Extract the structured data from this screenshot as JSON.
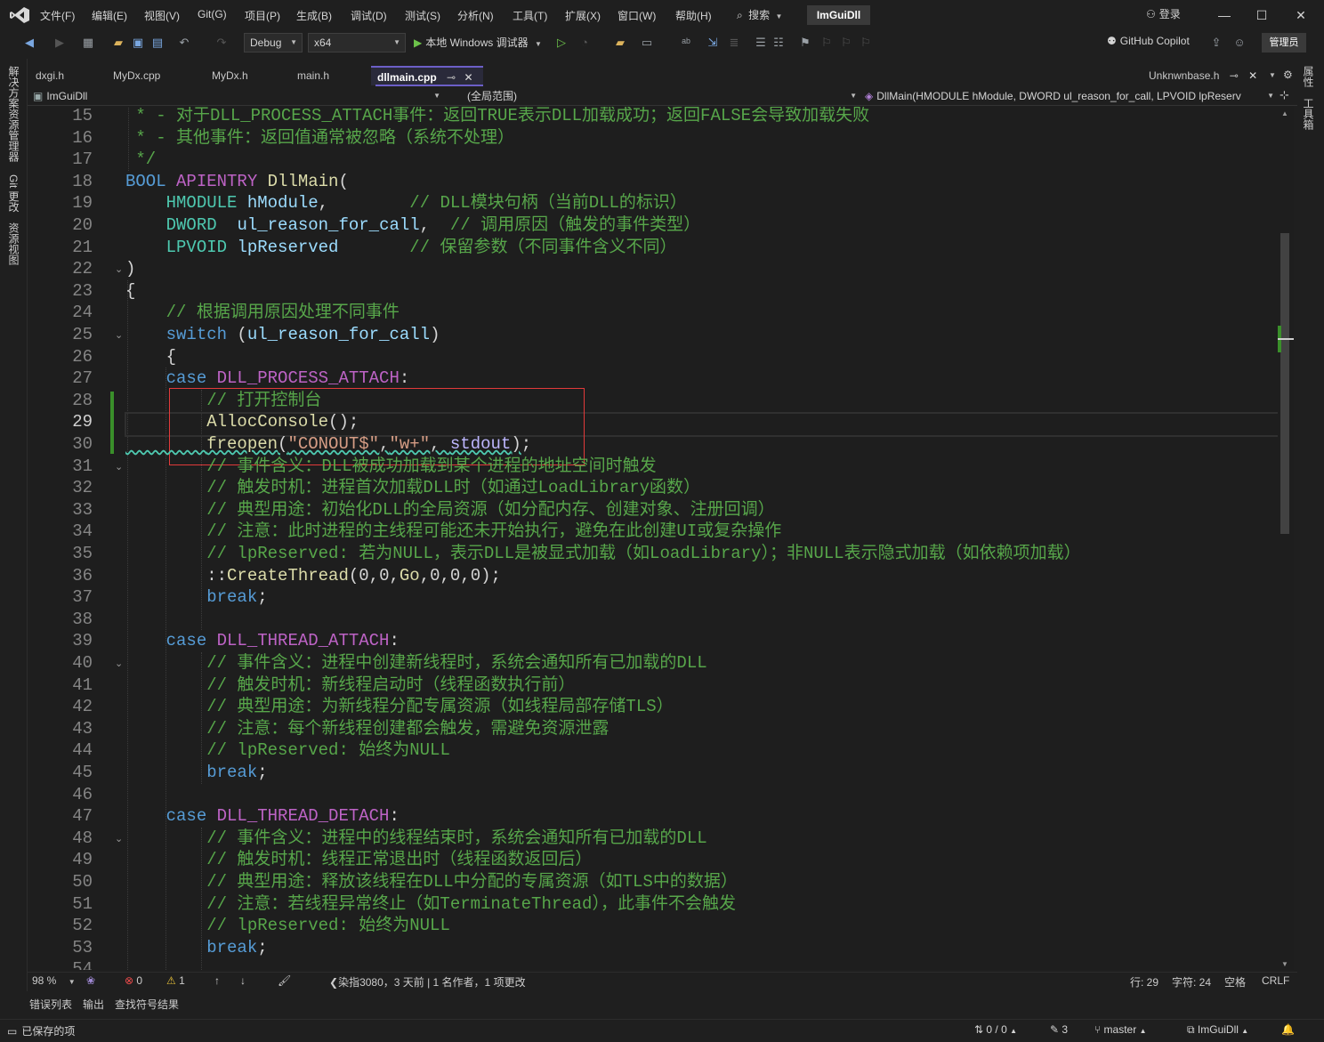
{
  "titlebar": {
    "menu": [
      "文件(F)",
      "编辑(E)",
      "视图(V)",
      "Git(G)",
      "项目(P)",
      "生成(B)",
      "调试(D)",
      "测试(S)",
      "分析(N)",
      "工具(T)",
      "扩展(X)",
      "窗口(W)",
      "帮助(H)"
    ],
    "search_label": "搜索",
    "solution_name": "ImGuiDll",
    "login_label": "登录"
  },
  "toolbar": {
    "config": "Debug",
    "platform": "x64",
    "run_label": "本地 Windows 调试器",
    "copilot_label": "GitHub Copilot",
    "admin_label": "管理员"
  },
  "side_left": [
    "解决方案资源管理器",
    "Git 更改",
    "资源视图"
  ],
  "side_right": [
    "属性",
    "工具箱"
  ],
  "tabs": [
    {
      "label": "dxgi.h",
      "active": false
    },
    {
      "label": "MyDx.cpp",
      "active": false
    },
    {
      "label": "MyDx.h",
      "active": false
    },
    {
      "label": "main.h",
      "active": false
    },
    {
      "label": "dllmain.cpp",
      "active": true
    },
    {
      "label": "Unknwnbase.h",
      "active": false
    }
  ],
  "navbar": {
    "project": "ImGuiDll",
    "scope": "(全局范围)",
    "member": "DllMain(HMODULE hModule, DWORD ul_reason_for_call, LPVOID lpReserv"
  },
  "editor": {
    "current_line": 29,
    "lines": [
      {
        "n": "15",
        "text": " * - 对于DLL_PROCESS_ATTACH事件：返回TRUE表示DLL加载成功；返回FALSE会导致加载失败"
      },
      {
        "n": "16",
        "text": " * - 其他事件：返回值通常被忽略（系统不处理）"
      },
      {
        "n": "17",
        "text": " */"
      },
      {
        "n": "18",
        "text": "BOOL APIENTRY DllMain("
      },
      {
        "n": "19",
        "text": "    HMODULE hModule,        // DLL模块句柄（当前DLL的标识）"
      },
      {
        "n": "20",
        "text": "    DWORD  ul_reason_for_call,  // 调用原因（触发的事件类型）"
      },
      {
        "n": "21",
        "text": "    LPVOID lpReserved       // 保留参数（不同事件含义不同）"
      },
      {
        "n": "22",
        "text": ")"
      },
      {
        "n": "23",
        "text": "{"
      },
      {
        "n": "24",
        "text": "    // 根据调用原因处理不同事件"
      },
      {
        "n": "25",
        "text": "    switch (ul_reason_for_call)"
      },
      {
        "n": "26",
        "text": "    {"
      },
      {
        "n": "27",
        "text": "    case DLL_PROCESS_ATTACH:"
      },
      {
        "n": "28",
        "text": "        // 打开控制台"
      },
      {
        "n": "29",
        "text": "        AllocConsole();"
      },
      {
        "n": "30",
        "text": "        freopen(\"CONOUT$\",\"w+\", stdout);"
      },
      {
        "n": "31",
        "text": "        // 事件含义：DLL被成功加载到某个进程的地址空间时触发"
      },
      {
        "n": "32",
        "text": "        // 触发时机：进程首次加载DLL时（如通过LoadLibrary函数）"
      },
      {
        "n": "33",
        "text": "        // 典型用途：初始化DLL的全局资源（如分配内存、创建对象、注册回调）"
      },
      {
        "n": "34",
        "text": "        // 注意：此时进程的主线程可能还未开始执行，避免在此创建UI或复杂操作"
      },
      {
        "n": "35",
        "text": "        // lpReserved: 若为NULL，表示DLL是被显式加载（如LoadLibrary）；非NULL表示隐式加载（如依赖项加载）"
      },
      {
        "n": "36",
        "text": "        ::CreateThread(0,0,Go,0,0,0);"
      },
      {
        "n": "37",
        "text": "        break;"
      },
      {
        "n": "38",
        "text": ""
      },
      {
        "n": "39",
        "text": "    case DLL_THREAD_ATTACH:"
      },
      {
        "n": "40",
        "text": "        // 事件含义：进程中创建新线程时，系统会通知所有已加载的DLL"
      },
      {
        "n": "41",
        "text": "        // 触发时机：新线程启动时（线程函数执行前）"
      },
      {
        "n": "42",
        "text": "        // 典型用途：为新线程分配专属资源（如线程局部存储TLS）"
      },
      {
        "n": "43",
        "text": "        // 注意：每个新线程创建都会触发，需避免资源泄露"
      },
      {
        "n": "44",
        "text": "        // lpReserved: 始终为NULL"
      },
      {
        "n": "45",
        "text": "        break;"
      },
      {
        "n": "46",
        "text": ""
      },
      {
        "n": "47",
        "text": "    case DLL_THREAD_DETACH:"
      },
      {
        "n": "48",
        "text": "        // 事件含义：进程中的线程结束时，系统会通知所有已加载的DLL"
      },
      {
        "n": "49",
        "text": "        // 触发时机：线程正常退出时（线程函数返回后）"
      },
      {
        "n": "50",
        "text": "        // 典型用途：释放该线程在DLL中分配的专属资源（如TLS中的数据）"
      },
      {
        "n": "51",
        "text": "        // 注意：若线程异常终止（如TerminateThread），此事件不会触发"
      },
      {
        "n": "52",
        "text": "        // lpReserved: 始终为NULL"
      },
      {
        "n": "53",
        "text": "        break;"
      },
      {
        "n": "54",
        "text": ""
      }
    ]
  },
  "editor_status": {
    "zoom": "98 %",
    "errors": "0",
    "warnings": "1",
    "blame": "染指3080，3 天前 | 1 名作者，1 项更改",
    "line": "行: 29",
    "char": "字符: 24",
    "whitespace": "空格",
    "eol": "CRLF"
  },
  "panel_tabs": [
    "错误列表",
    "输出",
    "查找符号结果"
  ],
  "statusbar": {
    "saved": "已保存的项",
    "sync": "0 / 0",
    "pencil_count": "3",
    "branch": "master",
    "repo": "ImGuiDll"
  },
  "colors": {
    "accent": "#6c5fc7",
    "highlight_box": "#e23a3a",
    "change_bar": "#3a8f2a"
  }
}
